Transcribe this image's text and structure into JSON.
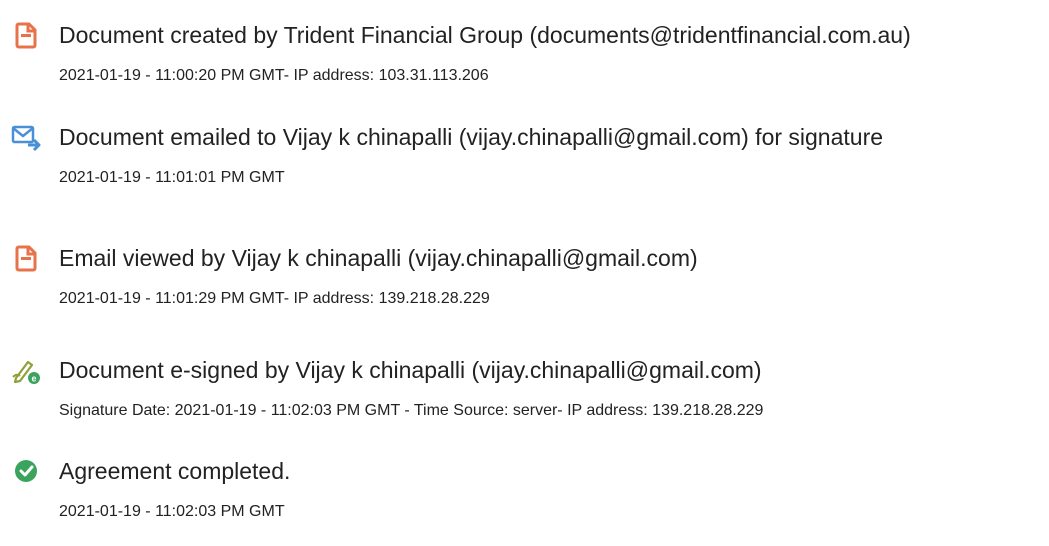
{
  "audit_events": [
    {
      "icon": "document-created-icon",
      "title": "Document created by Trident Financial Group (documents@tridentfinancial.com.au)",
      "detail": "2021-01-19 - 11:00:20 PM GMT- IP address: 103.31.113.206"
    },
    {
      "icon": "document-emailed-icon",
      "title": "Document emailed to Vijay k chinapalli (vijay.chinapalli@gmail.com) for signature",
      "detail": "2021-01-19 - 11:01:01 PM GMT"
    },
    {
      "icon": "email-viewed-icon",
      "title": "Email viewed by Vijay k chinapalli (vijay.chinapalli@gmail.com)",
      "detail": "2021-01-19 - 11:01:29 PM GMT- IP address: 139.218.28.229"
    },
    {
      "icon": "e-signed-pen-icon",
      "title": "Document e-signed by Vijay k chinapalli (vijay.chinapalli@gmail.com)",
      "detail": "Signature Date: 2021-01-19 - 11:02:03 PM GMT - Time Source: server- IP address: 139.218.28.229"
    },
    {
      "icon": "completed-check-icon",
      "title": "Agreement completed.",
      "detail": "2021-01-19 - 11:02:03 PM GMT"
    }
  ],
  "colors": {
    "document_icon": "#e8734a",
    "email_icon": "#4a90d9",
    "pen_icon": "#8fa13a",
    "check_icon": "#3aa35c",
    "text": "#222222"
  }
}
